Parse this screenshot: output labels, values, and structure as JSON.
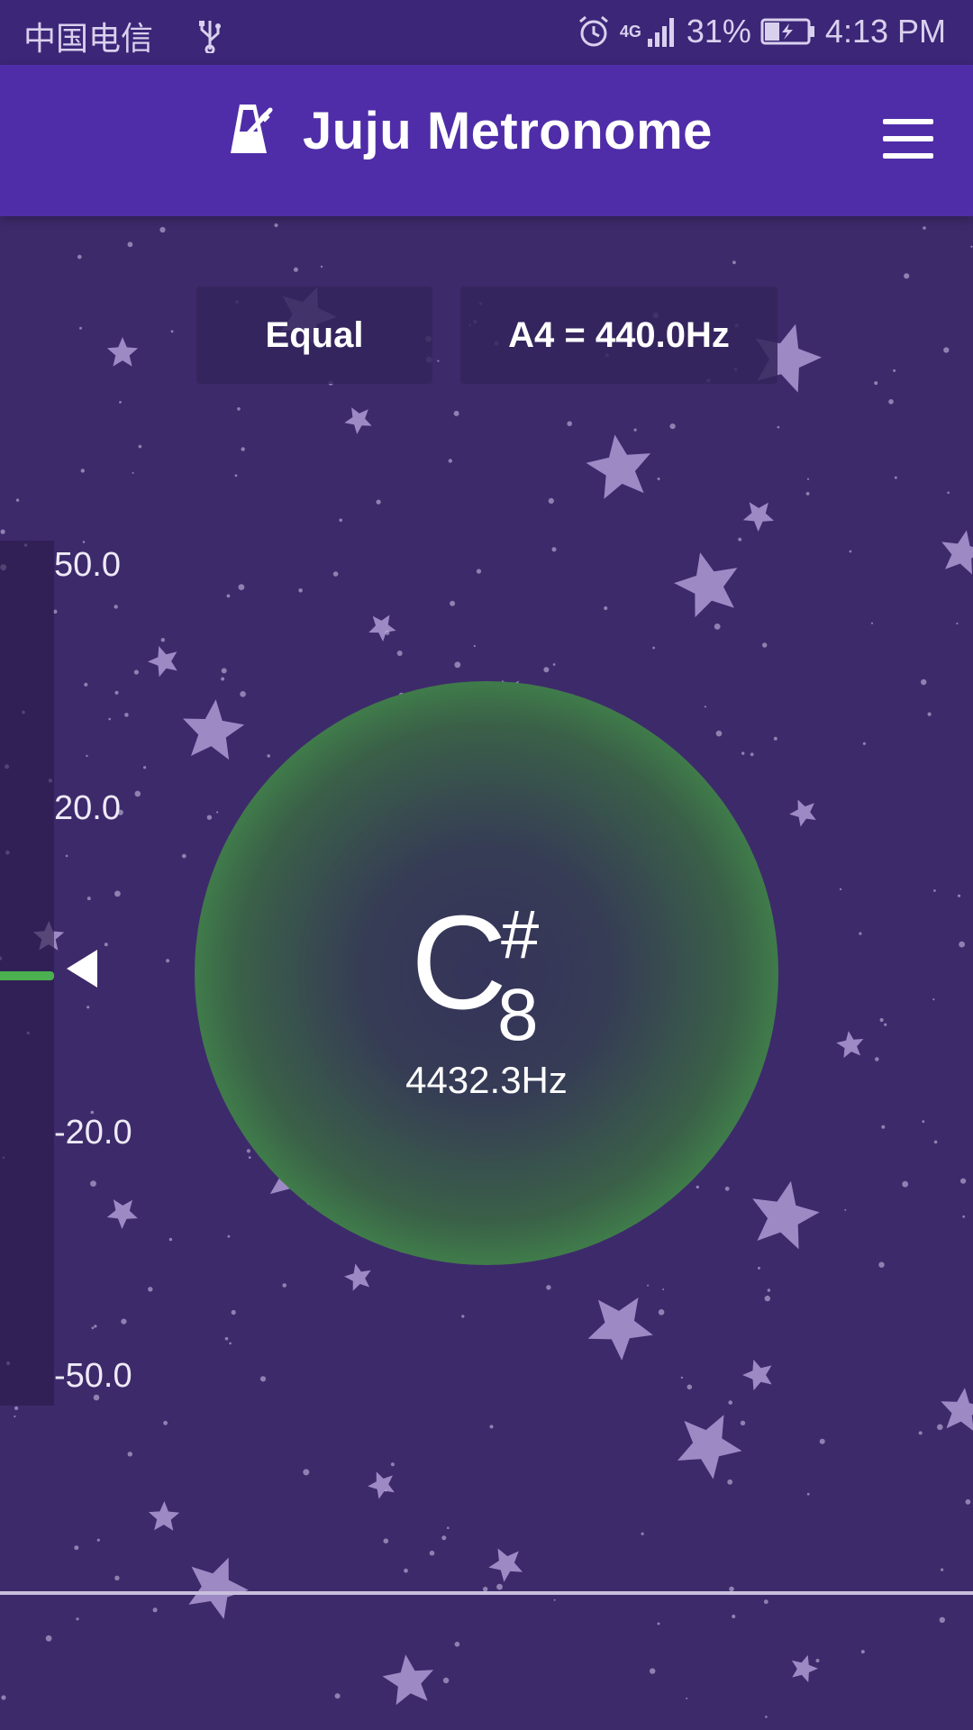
{
  "status_bar": {
    "carrier": "中国电信",
    "network": "4G",
    "battery": "31%",
    "time": "4:13 PM"
  },
  "app_bar": {
    "title": "Juju Metronome",
    "logo_icon": "metronome-icon",
    "menu_icon": "hamburger-menu-icon"
  },
  "controls": {
    "temperament": "Equal",
    "reference": "A4 = 440.0Hz"
  },
  "scale": {
    "labels": [
      "50.0",
      "20.0",
      "-20.0",
      "-50.0"
    ],
    "indicator_color": "#4caf50"
  },
  "note": {
    "name": "C",
    "accidental": "#",
    "octave": "8",
    "frequency": "4432.3Hz"
  },
  "colors": {
    "status_bar": "#3b2677",
    "app_bar": "#4f2da8",
    "background": "#3d2a6b",
    "accent_green": "#4caf50"
  }
}
